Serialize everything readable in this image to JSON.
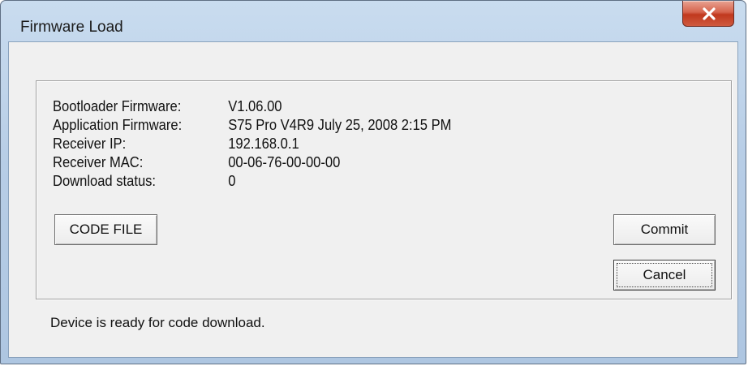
{
  "window": {
    "title": "Firmware Load",
    "close_icon": "close-icon"
  },
  "info": {
    "rows": [
      {
        "label": "Bootloader Firmware:",
        "value": "V1.06.00"
      },
      {
        "label": "Application Firmware:",
        "value": "S75 Pro V4R9 July 25, 2008 2:15 PM"
      },
      {
        "label": "Receiver IP:",
        "value": "192.168.0.1"
      },
      {
        "label": "Receiver MAC:",
        "value": "00-06-76-00-00-00"
      },
      {
        "label": "Download status:",
        "value": "0"
      }
    ]
  },
  "buttons": {
    "code_file": "CODE FILE",
    "commit": "Commit",
    "cancel": "Cancel"
  },
  "status": {
    "message": "Device is ready for code download."
  },
  "colors": {
    "frame": "#b7cde6",
    "close_button": "#c0381e",
    "client_background": "#f0f0f0"
  }
}
